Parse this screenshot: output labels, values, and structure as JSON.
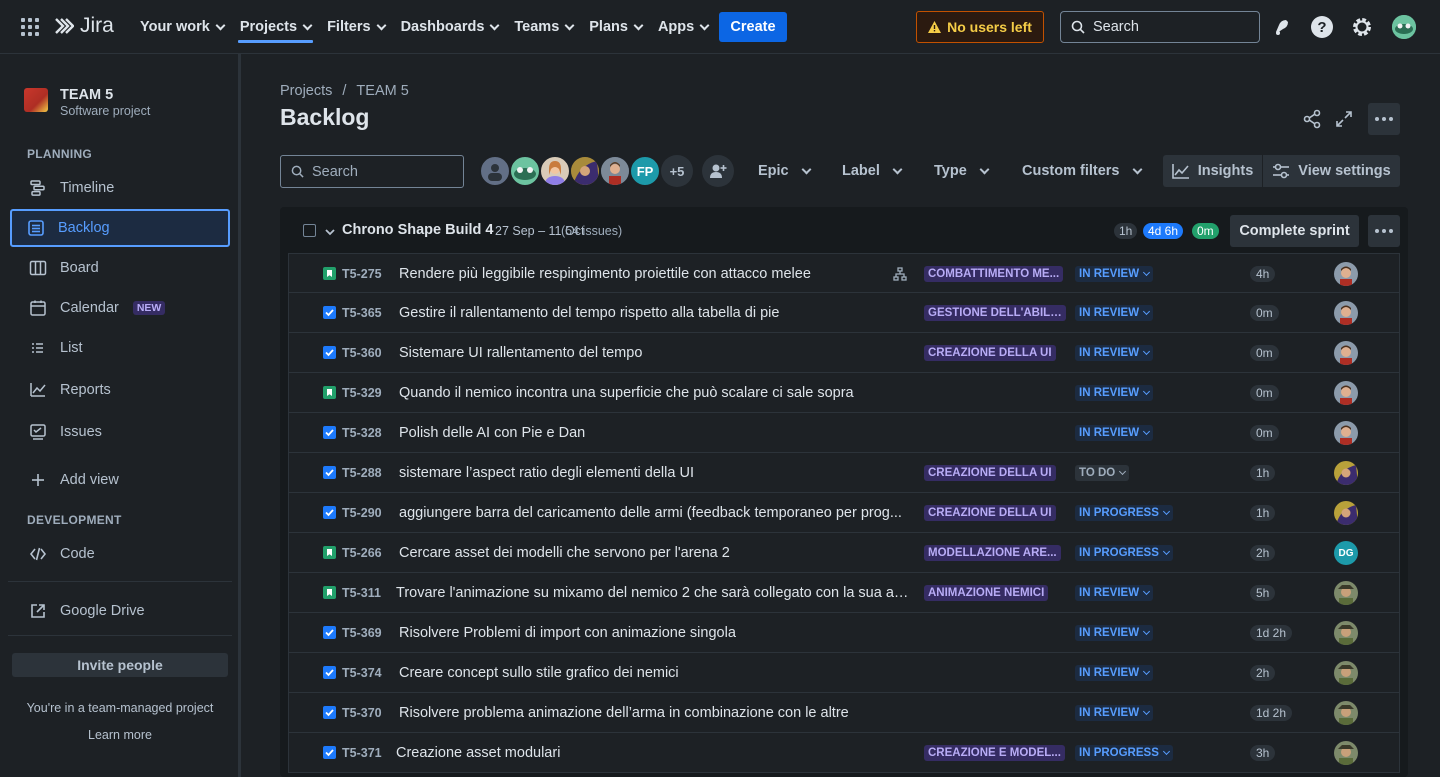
{
  "topnav": {
    "logo_text": "Jira",
    "items": [
      {
        "label": "Your work"
      },
      {
        "label": "Projects"
      },
      {
        "label": "Filters"
      },
      {
        "label": "Dashboards"
      },
      {
        "label": "Teams"
      },
      {
        "label": "Plans"
      },
      {
        "label": "Apps"
      }
    ],
    "create_label": "Create",
    "warning_label": "No users left",
    "search_placeholder": "Search"
  },
  "sidebar": {
    "project_name": "TEAM 5",
    "project_type": "Software project",
    "planning_label": "PLANNING",
    "items": [
      {
        "label": "Timeline",
        "icon": "timeline-icon"
      },
      {
        "label": "Backlog",
        "icon": "backlog-icon"
      },
      {
        "label": "Board",
        "icon": "board-icon"
      },
      {
        "label": "Calendar",
        "icon": "calendar-icon",
        "badge": "NEW"
      },
      {
        "label": "List",
        "icon": "list-icon"
      },
      {
        "label": "Reports",
        "icon": "reports-icon"
      },
      {
        "label": "Issues",
        "icon": "issues-icon"
      },
      {
        "label": "Add view",
        "icon": "plus-icon"
      }
    ],
    "development_label": "DEVELOPMENT",
    "code_label": "Code",
    "google_drive_label": "Google Drive",
    "invite_label": "Invite people",
    "team_note": "You're in a team-managed project",
    "learn_more": "Learn more"
  },
  "main": {
    "breadcrumb": {
      "projects": "Projects",
      "separator": "/",
      "project": "TEAM 5"
    },
    "title": "Backlog",
    "search_placeholder": "Search",
    "avatars": {
      "initials_fp": "FP",
      "more": "+5"
    },
    "filters": {
      "epic": "Epic",
      "label": "Label",
      "type": "Type",
      "custom": "Custom filters"
    },
    "insights_label": "Insights",
    "view_settings_label": "View settings"
  },
  "sprint": {
    "name": "Chrono Shape Build 4",
    "dates": "27 Sep – 11 Oct",
    "count": "(54 issues)",
    "pill_todo": "1h",
    "pill_progress": "4d 6h",
    "pill_done": "0m",
    "complete_label": "Complete sprint"
  },
  "colors": {
    "accent": "#579dff",
    "create": "#0c66e4",
    "epic_bg": "#352c63",
    "epic_text": "#b8acf6",
    "story": "#22a06b",
    "task": "#1d7afc"
  },
  "issues": [
    {
      "type": "story",
      "key": "T5-275",
      "summary": "Rendere più leggibile respingimento proiettile con attacco melee",
      "epic": "COMBATTIMENTO ME...",
      "status": "IN REVIEW",
      "estimate": "4h",
      "assignee": "a1"
    },
    {
      "type": "task",
      "key": "T5-365",
      "summary": "Gestire il rallentamento del tempo rispetto alla tabella di pie",
      "epic": "GESTIONE DELL'ABILI...",
      "status": "IN REVIEW",
      "estimate": "0m",
      "assignee": "a1"
    },
    {
      "type": "task",
      "key": "T5-360",
      "summary": "Sistemare UI rallentamento del tempo",
      "epic": "CREAZIONE DELLA UI",
      "status": "IN REVIEW",
      "estimate": "0m",
      "assignee": "a1"
    },
    {
      "type": "story",
      "key": "T5-329",
      "summary": "Quando il nemico incontra una superficie che può scalare ci sale sopra",
      "epic": "",
      "status": "IN REVIEW",
      "estimate": "0m",
      "assignee": "a1"
    },
    {
      "type": "task",
      "key": "T5-328",
      "summary": "Polish delle AI con Pie e Dan",
      "epic": "",
      "status": "IN REVIEW",
      "estimate": "0m",
      "assignee": "a1"
    },
    {
      "type": "task",
      "key": "T5-288",
      "summary": "sistemare l’aspect ratio degli elementi della UI",
      "epic": "CREAZIONE DELLA UI",
      "status": "TO DO",
      "estimate": "1h",
      "assignee": "a2"
    },
    {
      "type": "task",
      "key": "T5-290",
      "summary": "aggiungere barra del caricamento delle armi (feedback temporaneo per prog...",
      "epic": "CREAZIONE DELLA UI",
      "status": "IN PROGRESS",
      "estimate": "1h",
      "assignee": "a2"
    },
    {
      "type": "story",
      "key": "T5-266",
      "summary": "Cercare asset dei modelli che servono per l'arena 2",
      "epic": "MODELLAZIONE ARE...",
      "status": "IN PROGRESS",
      "estimate": "2h",
      "assignee": "dg",
      "initials": "DG"
    },
    {
      "type": "story",
      "key": "T5-311",
      "summary": "Trovare l'animazione su mixamo del nemico 2 che sarà collegato con la sua ar...",
      "epic": "ANIMAZIONE NEMICI",
      "status": "IN REVIEW",
      "estimate": "5h",
      "assignee": "a3"
    },
    {
      "type": "task",
      "key": "T5-369",
      "summary": "Risolvere Problemi di import con animazione singola",
      "epic": "",
      "status": "IN REVIEW",
      "estimate": "1d 2h",
      "assignee": "a3"
    },
    {
      "type": "task",
      "key": "T5-374",
      "summary": "Creare concept sullo stile grafico dei nemici",
      "epic": "",
      "status": "IN REVIEW",
      "estimate": "2h",
      "assignee": "a3"
    },
    {
      "type": "task",
      "key": "T5-370",
      "summary": "Risolvere problema animazione dell’arma in combinazione con le altre",
      "epic": "",
      "status": "IN REVIEW",
      "estimate": "1d 2h",
      "assignee": "a3"
    },
    {
      "type": "task",
      "key": "T5-371",
      "summary": "Creazione asset modulari",
      "epic": "CREAZIONE E MODEL...",
      "status": "IN PROGRESS",
      "estimate": "3h",
      "assignee": "a3"
    }
  ]
}
